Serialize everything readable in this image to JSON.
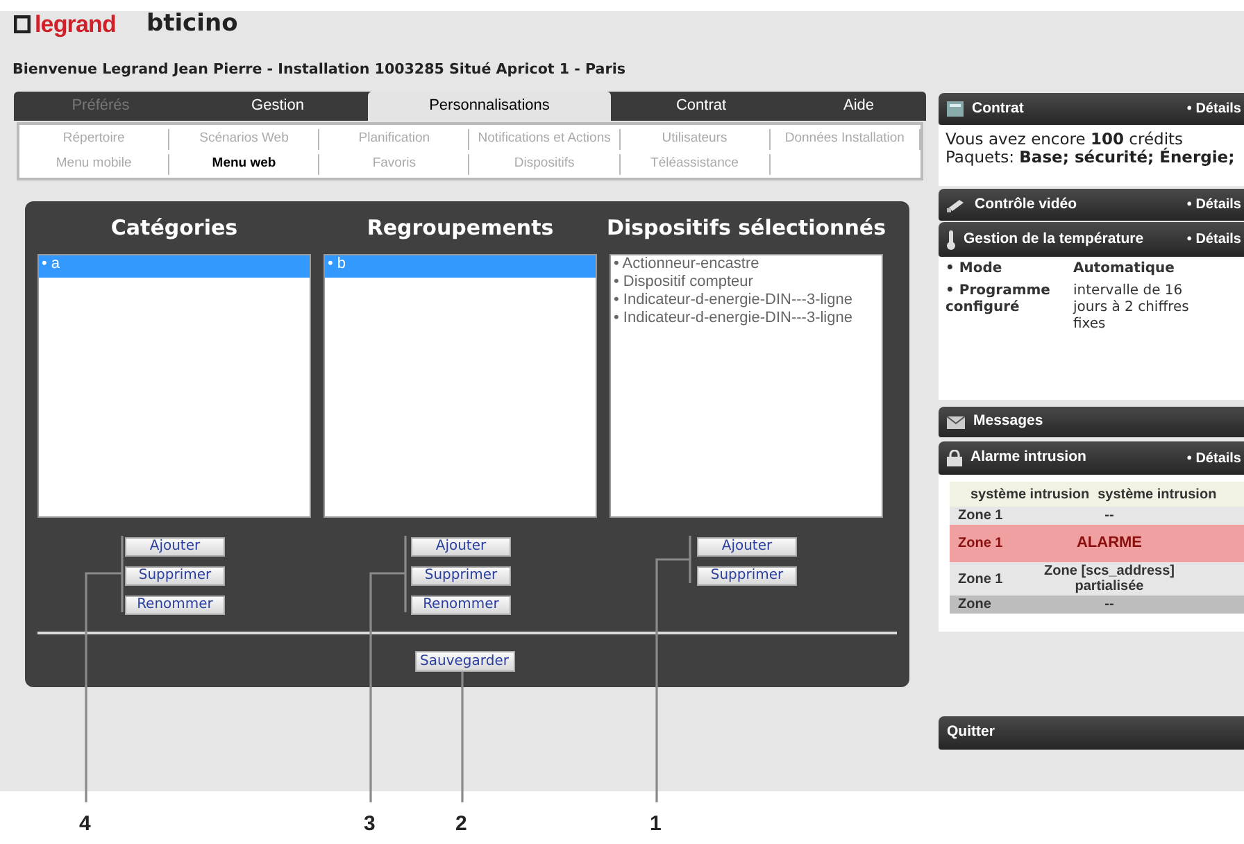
{
  "logos": {
    "brand_1": "legrand",
    "brand_2": "bticino"
  },
  "welcome": "Bienvenue Legrand Jean Pierre - Installation 1003285 Situé Apricot 1 - Paris",
  "tabs": [
    {
      "label": "Préférés",
      "selected": false,
      "disabled": true
    },
    {
      "label": "Gestion",
      "selected": false,
      "disabled": false
    },
    {
      "label": "Personnalisations",
      "selected": true,
      "disabled": false
    },
    {
      "label": "Contrat",
      "selected": false,
      "disabled": false
    },
    {
      "label": "Aide",
      "selected": false,
      "disabled": false
    }
  ],
  "subtabs": [
    {
      "label": "Répertoire",
      "selected": false
    },
    {
      "label": "Scénarios Web",
      "selected": false
    },
    {
      "label": "Planification",
      "selected": false
    },
    {
      "label": "Notifications et Actions",
      "selected": false
    },
    {
      "label": "Utilisateurs",
      "selected": false
    },
    {
      "label": "Données Installation",
      "selected": false
    },
    {
      "label": "Menu mobile",
      "selected": false
    },
    {
      "label": "Menu web",
      "selected": true
    },
    {
      "label": "Favoris",
      "selected": false
    },
    {
      "label": "Dispositifs",
      "selected": false
    },
    {
      "label": "Téléassistance",
      "selected": false
    }
  ],
  "columns": [
    {
      "title": "Catégories",
      "items": [
        {
          "label": "• a",
          "selected": true
        }
      ],
      "buttons": [
        "Ajouter",
        "Supprimer",
        "Renommer"
      ]
    },
    {
      "title": "Regroupements",
      "items": [
        {
          "label": "• b",
          "selected": true
        }
      ],
      "buttons": [
        "Ajouter",
        "Supprimer",
        "Renommer"
      ]
    },
    {
      "title": "Dispositifs sélectionnés",
      "items": [
        {
          "label": "• Actionneur-encastre",
          "selected": false
        },
        {
          "label": "• Dispositif compteur",
          "selected": false
        },
        {
          "label": "• Indicateur-d-energie-DIN---3-ligne",
          "selected": false
        },
        {
          "label": "• Indicateur-d-energie-DIN---3-ligne",
          "selected": false
        }
      ],
      "buttons": [
        "Ajouter",
        "Supprimer"
      ]
    }
  ],
  "save_button": "Sauvegarder",
  "widgets": [
    {
      "kind": "text",
      "title": "Contrat",
      "link": "• Détails",
      "lines": [
        "Vous avez encore **100** crédits",
        "Paquets: **Base; sécurité; Énergie;**"
      ]
    },
    {
      "kind": "bar",
      "title": "Contrôle vidéo",
      "link": "• Détails"
    },
    {
      "kind": "pairs",
      "title": "Gestion de la température",
      "link": "• Détails",
      "rows": [
        {
          "label": "• Mode",
          "value": "Automatique",
          "bold": true
        },
        {
          "label": "• Programme configuré",
          "value": "intervalle de 16 jours à 2 chiffres fixes",
          "bold": false
        }
      ]
    },
    {
      "kind": "bar",
      "title": "Messages"
    },
    {
      "kind": "table",
      "title": "Alarme intrusion",
      "link": "• Détails",
      "columns": [
        "système intrusion",
        "système intrusion"
      ],
      "rows": [
        {
          "zone": "Zone 1",
          "state": "--",
          "kind": "normal"
        },
        {
          "zone": "Zone 1",
          "state": "ALARME",
          "kind": "alarm"
        },
        {
          "zone": "Zone 1",
          "state": "Zone [scs_address] partialisée",
          "kind": "normal"
        },
        {
          "zone": "Zone",
          "state": "--",
          "kind": "dim"
        }
      ]
    },
    {
      "kind": "bar",
      "title": "Quitter"
    }
  ],
  "callouts": [
    "4",
    "3",
    "2",
    "1"
  ]
}
